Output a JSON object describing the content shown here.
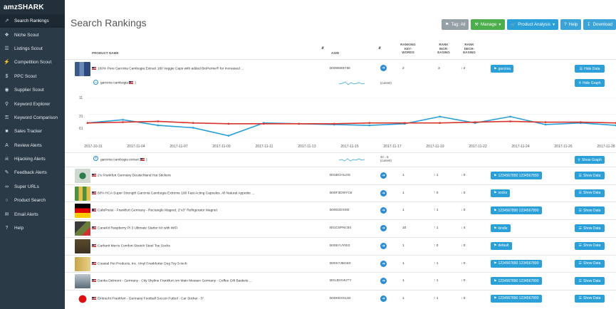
{
  "app": {
    "brand": "amzSHARK"
  },
  "sidebar": {
    "items": [
      {
        "label": "Search Rankings",
        "icon": "trend-chart-icon",
        "active": true
      },
      {
        "label": "Niche Scout",
        "icon": "compass-icon"
      },
      {
        "label": "Listings Scout",
        "icon": "list-icon"
      },
      {
        "label": "Competition Scout",
        "icon": "bolt-icon"
      },
      {
        "label": "PPC Scout",
        "icon": "dollar-icon"
      },
      {
        "label": "Supplier Scout",
        "icon": "globe-icon"
      },
      {
        "label": "Keyword Explorer",
        "icon": "search-icon"
      },
      {
        "label": "Keyword Comparison",
        "icon": "key-icon"
      },
      {
        "label": "Sales Tracker",
        "icon": "bar-chart-icon"
      },
      {
        "label": "Review Alerts",
        "icon": "font-a-icon"
      },
      {
        "label": "Hijacking Alerts",
        "icon": "pirate-icon"
      },
      {
        "label": "Feedback Alerts",
        "icon": "feedback-icon"
      },
      {
        "label": "Super URLs",
        "icon": "link-icon"
      },
      {
        "label": "Product Search",
        "icon": "chat-search-icon"
      },
      {
        "label": "Email Alerts",
        "icon": "envelope-icon"
      },
      {
        "label": "Help",
        "icon": "question-icon"
      }
    ]
  },
  "page": {
    "title": "Search Rankings"
  },
  "toolbar": {
    "tag": "Tag: All",
    "manage": "Manage",
    "analysis": "Product Analysis",
    "help": "Help",
    "download": "Download"
  },
  "table": {
    "headers": {
      "product_name": "PRODUCT NAME",
      "asin": "ASIN",
      "ranking_keywords": "RANKING KEY-WORDS",
      "rank_increasing": "RANK INCR-EASING",
      "rank_decreasing": "RANK DECR-EASING"
    },
    "expanded": {
      "name": "100% Pure Garcinia Cambogia Extract 180 Veggie Caps with added BioPerine® for Increased ...",
      "asin": "B000EB9Y88",
      "ranking_keywords": "2",
      "rank_increasing": "3",
      "rank_decreasing": "2",
      "keyword_tag": "garcinia",
      "action": "Hide Data",
      "graph_keyword": "garcinia cambogia",
      "graph_note": "(current)",
      "graph_action": "Hide Graph",
      "second_keyword": "garcinia cambogia extract",
      "second_rank": "43",
      "second_change": "5",
      "second_note": "(current)",
      "second_action": "Show Graph"
    },
    "rows": [
      {
        "name": "2's Frankfurt Germany Deutschland Hat Stickers",
        "asin": "B01BCHUJIS",
        "rk": "1",
        "inc": "1",
        "dec": "0",
        "tag": "1234567890 1234567890",
        "action": "Show Data"
      },
      {
        "name": "60% HCA Super Strength Garcinia Cambogia Extreme 180 Fast Acting Capsules. All Natural Appetite ...",
        "asin": "B00F3DWYC6",
        "rk": "1",
        "inc": "0",
        "dec": "0",
        "tag": "socks",
        "action": "Show Data"
      },
      {
        "name": "CafePress - Frankfurt Germany - Rectangle Magnet, 2\"x3\" Refrigerator Magnet",
        "asin": "B0002DX0IE",
        "rk": "1",
        "inc": "1",
        "dec": "0",
        "tag": "1234567890 1234567890",
        "action": "Show Data"
      },
      {
        "name": "CanaKit Raspberry Pi 3 Ultimate Starter Kit with WiFi",
        "asin": "B01C6PNC84",
        "rk": "10",
        "inc": "1",
        "dec": "4",
        "tag": "kindle",
        "action": "Show Data"
      },
      {
        "name": "Carhartt Men's Comfort Stretch Steel Toe Socks",
        "asin": "B005YUYIE0",
        "rk": "1",
        "inc": "0",
        "dec": "0",
        "tag": "default",
        "action": "Show Data"
      },
      {
        "name": "Coastal Pet Products, Inc. Vinyl Frankfurter Dog Toy 5-Inch",
        "asin": "B00X7JBGE0",
        "rk": "1",
        "inc": "1",
        "dec": "0",
        "tag": "1234567890 1234567890",
        "action": "Show Data"
      },
      {
        "name": "Danka Delmont - Germany - City Skyline Frankfurt Am Main Messen Germany - Coffee Gift Baskets ...",
        "asin": "B01JDXHUTY",
        "rk": "1",
        "inc": "1",
        "dec": "0",
        "tag": "1234567890 1234567890",
        "action": "Show Data"
      },
      {
        "name": "Eintracht Frankfurt - Germany Football Soccer Futbol - Car Sticker - 5\"",
        "asin": "B00KDXSL50",
        "rk": "1",
        "inc": "1",
        "dec": "0",
        "tag": "1234567890 1234567890",
        "action": "Show Data"
      }
    ]
  },
  "chart_data": {
    "type": "line",
    "y_ticks": [
      "11",
      "31",
      "61"
    ],
    "x": [
      "2017-10-31",
      "2017-11-04",
      "2017-11-07",
      "2017-11-09",
      "2017-11-11",
      "2017-11-13",
      "2017-11-15",
      "2017-11-17",
      "2017-11-19",
      "2017-11-22",
      "2017-11-24",
      "2017-11-26",
      "2017-11-28"
    ],
    "series": [
      {
        "color": "#2a9fd8",
        "values": [
          42,
          38,
          45,
          48,
          58,
          42,
          43,
          44,
          45,
          43,
          34,
          42,
          34,
          44,
          42,
          45
        ]
      },
      {
        "color": "#d9342b",
        "values": [
          42,
          41,
          40,
          42,
          43,
          43,
          43,
          43,
          42,
          42,
          42,
          41,
          40,
          41,
          41,
          42
        ]
      }
    ]
  },
  "colors": {
    "sidebar": "#2b3a47",
    "accent": "#2a9fd8",
    "green": "#4cae4c"
  }
}
